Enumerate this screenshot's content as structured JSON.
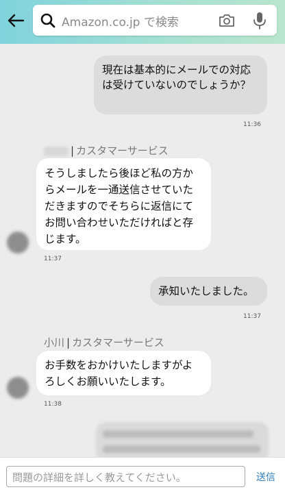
{
  "header": {
    "back_icon": "arrow-left-icon",
    "search_placeholder": "Amazon.co.jp で検索",
    "camera_icon": "camera-icon",
    "mic_icon": "microphone-icon",
    "search_icon": "search-icon"
  },
  "messages": {
    "m1": {
      "text": "現在は基本的にメールでの対応は受けていないのでしょうか？",
      "time": "11:36"
    },
    "m2": {
      "agent_role": "カスタマーサービス",
      "text": "そうしましたら後ほど私の方からメールを一通送信させていただきますのでそちらに返信にてお問い合わせいただければと存じます。",
      "time": "11:37"
    },
    "m3": {
      "text": "承知いたしました。",
      "time": "11:37"
    },
    "m4": {
      "agent_name": "小川",
      "agent_role": "カスタマーサービス",
      "text": "お手数をおかけいたしますがよろしくお願いいたします。",
      "time": "11:38"
    }
  },
  "composer": {
    "placeholder": "問題の詳細を詳しく教えてください。",
    "send_label": "送信"
  },
  "colors": {
    "accent": "#2f7fb7",
    "header_start": "#7fd3dc",
    "header_end": "#b9e6cc"
  }
}
